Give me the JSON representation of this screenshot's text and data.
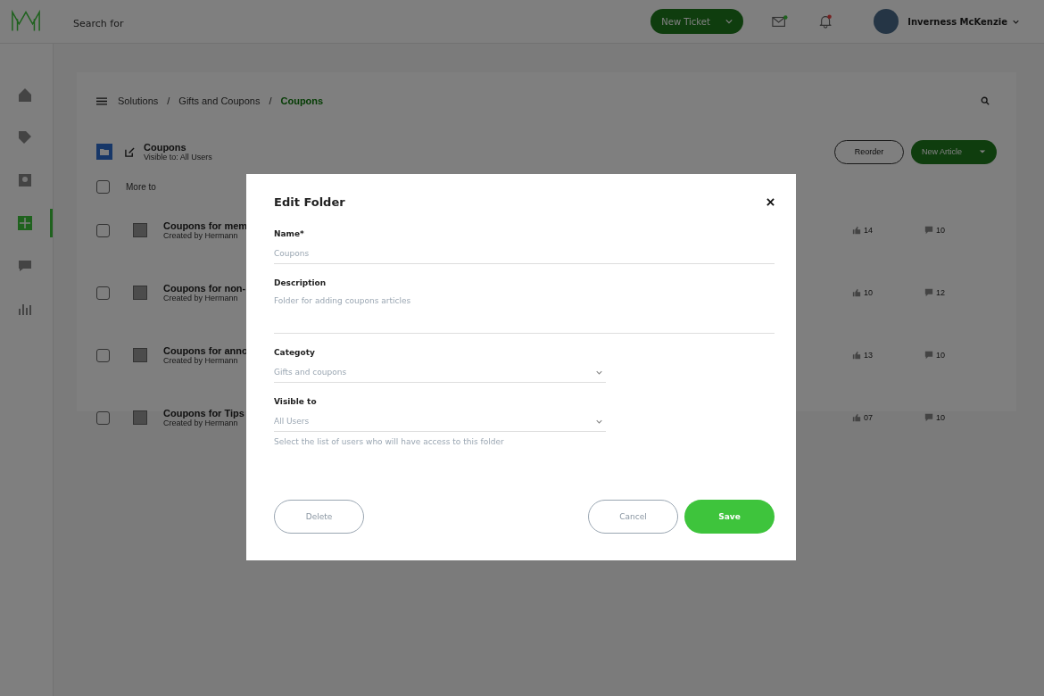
{
  "header": {
    "search_placeholder": "Search for",
    "new_ticket": "New Ticket",
    "user_name": "Inverness McKenzie"
  },
  "sidebar": {
    "items": [
      {
        "kind": "home",
        "selected": false
      },
      {
        "kind": "tag",
        "selected": false
      },
      {
        "kind": "contacts",
        "selected": false
      },
      {
        "kind": "solutions",
        "selected": true
      },
      {
        "kind": "chat",
        "selected": false
      },
      {
        "kind": "analytics",
        "selected": false
      }
    ]
  },
  "breadcrumbs": [
    {
      "label": "Solutions",
      "selected": false
    },
    {
      "separator": "/",
      "label": "Gifts and Coupons",
      "selected": false
    },
    {
      "separator": "/",
      "label": "Coupons",
      "selected": true
    }
  ],
  "folder": {
    "title": "Coupons",
    "subtitle": "Visible to: All Users",
    "reorder": "Reorder",
    "new_article": "New Article",
    "more": "More to",
    "checked": false
  },
  "articles": [
    {
      "title": "Coupons for mem",
      "meta": "Created by Hermann",
      "likes": "14",
      "comments": "10",
      "checked": false
    },
    {
      "title": "Coupons for non-",
      "meta": "Created by Hermann",
      "likes": "10",
      "comments": "12",
      "checked": false
    },
    {
      "title": "Coupons for anno",
      "meta": "Created by Hermann",
      "likes": "13",
      "comments": "10",
      "checked": false
    },
    {
      "title": "Coupons for Tips",
      "meta": "Created by Hermann",
      "likes": "07",
      "comments": "10",
      "checked": false
    }
  ],
  "dialog": {
    "title": "Edit Folder",
    "fields": [
      {
        "kind": "text",
        "label": "Name*",
        "value": "Coupons"
      },
      {
        "kind": "textarea",
        "label": "Description",
        "value": "Folder for adding coupons articles"
      },
      {
        "kind": "select",
        "label": "Categoty",
        "value": "Gifts and coupons"
      },
      {
        "kind": "select",
        "label": "Visible to",
        "value": "All Users",
        "hint": "Select the list of users who will have access to this folder"
      }
    ],
    "delete": "Delete",
    "cancel": "Cancel",
    "save": "Save"
  }
}
